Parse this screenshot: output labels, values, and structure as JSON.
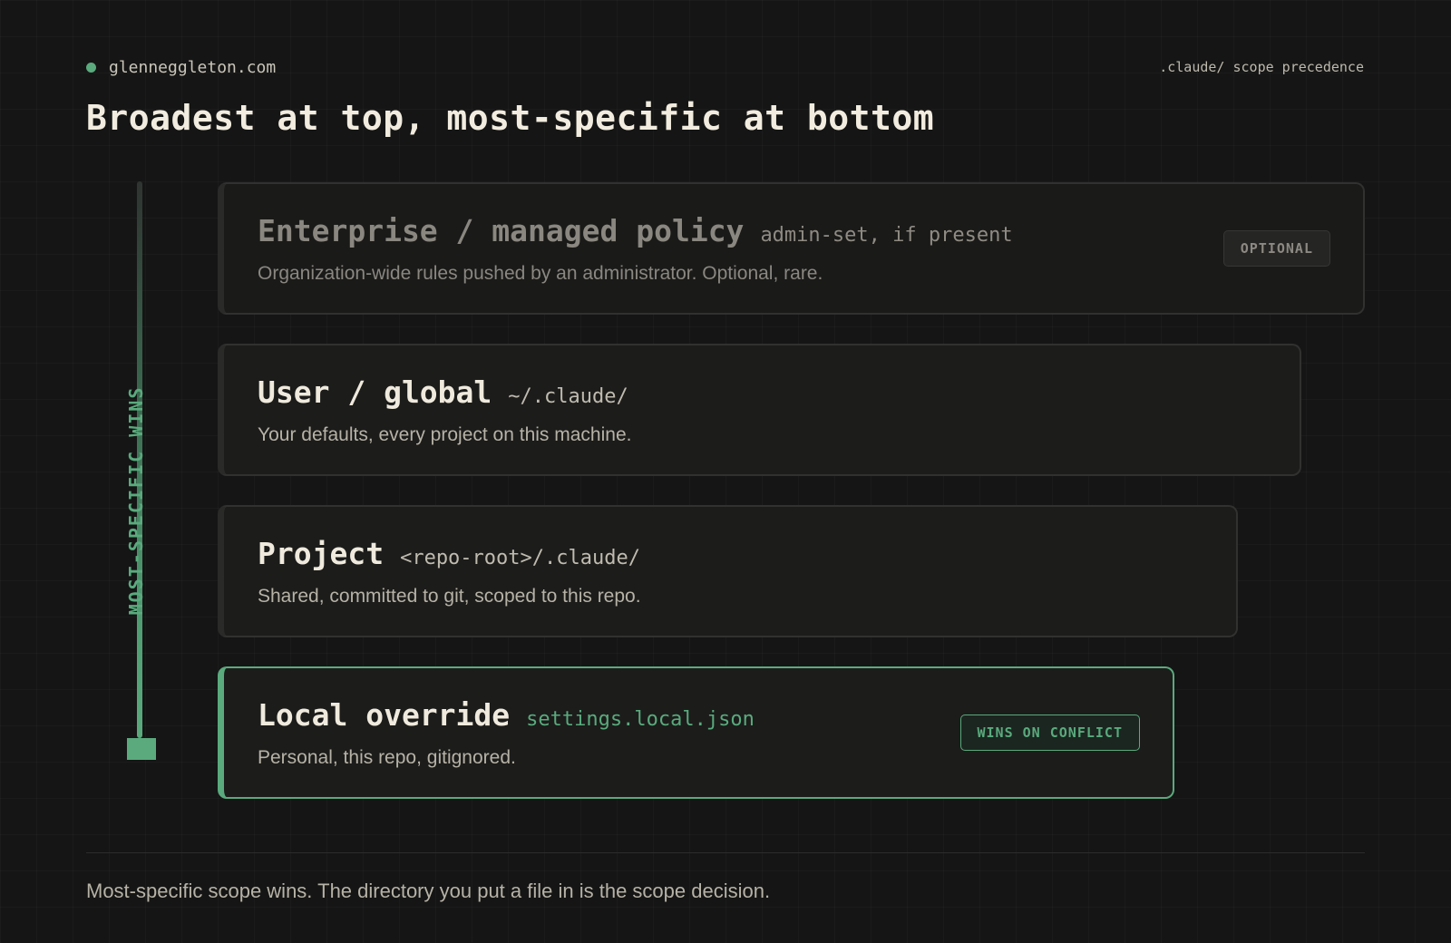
{
  "header": {
    "site": "glenneggleton.com",
    "context": ".claude/ scope precedence",
    "title": "Broadest at top, most-specific at bottom"
  },
  "rail": {
    "label": "MOST-SPECIFIC WINS"
  },
  "scopes": [
    {
      "name": "Enterprise / managed policy",
      "path": "admin-set, if present",
      "description": "Organization-wide rules pushed by an administrator. Optional, rare.",
      "badge": "OPTIONAL"
    },
    {
      "name": "User / global",
      "path": "~/.claude/",
      "description": "Your defaults, every project on this machine."
    },
    {
      "name": "Project",
      "path": "<repo-root>/.claude/",
      "description": "Shared, committed to git, scoped to this repo."
    },
    {
      "name": "Local override",
      "path": "settings.local.json",
      "description": "Personal, this repo, gitignored.",
      "badge": "WINS ON CONFLICT"
    }
  ],
  "footer": {
    "text": "Most-specific scope wins. The directory you put a file in is the scope decision."
  },
  "colors": {
    "background": "#151515",
    "accent": "#5aaa7d",
    "card": "#1c1c1b"
  }
}
